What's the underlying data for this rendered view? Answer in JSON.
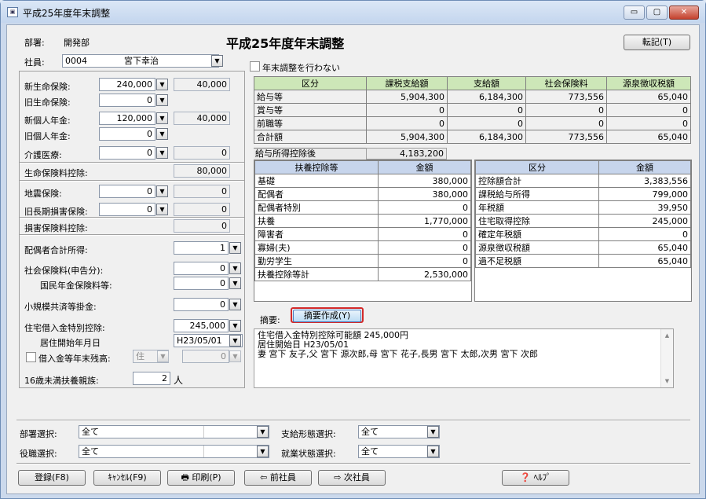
{
  "window": {
    "title": "平成25年度年末調整",
    "icon": "app-icon",
    "minimize": "▭",
    "maximize": "▢",
    "close": "✕"
  },
  "heading": "平成25年度年末調整",
  "transfer_button": "転記(T)",
  "header": {
    "dept_label": "部署:",
    "dept_value": "開発部",
    "employee_label": "社員:",
    "employee_code": "0004",
    "employee_name": "宮下幸治"
  },
  "no_adjust_label": "年末調整を行わない",
  "left": {
    "new_life_label": "新生命保険:",
    "new_life_value": "240,000",
    "new_life_calc": "40,000",
    "old_life_label": "旧生命保険:",
    "old_life_value": "0",
    "new_pension_label": "新個人年金:",
    "new_pension_value": "120,000",
    "new_pension_calc": "40,000",
    "old_pension_label": "旧個人年金:",
    "old_pension_value": "0",
    "care_label": "介護医療:",
    "care_value": "0",
    "care_calc": "0",
    "life_deduction_label": "生命保険料控除:",
    "life_deduction_value": "80,000",
    "earthquake_label": "地震保険:",
    "earthquake_value": "0",
    "earthquake_calc": "0",
    "old_longterm_label": "旧長期損害保険:",
    "old_longterm_value": "0",
    "old_longterm_calc": "0",
    "damage_deduction_label": "損害保険料控除:",
    "damage_deduction_value": "0",
    "spouse_income_label": "配偶者合計所得:",
    "spouse_income_value": "1",
    "social_ins_label": "社会保険料(申告分):",
    "social_ins_value": "0",
    "national_pension_label": "国民年金保険料等:",
    "national_pension_value": "0",
    "small_biz_label": "小規模共済等掛金:",
    "small_biz_value": "0",
    "housing_loan_label": "住宅借入金特別控除:",
    "housing_loan_value": "245,000",
    "residence_start_label": "居住開始年月日",
    "residence_start_value": "H23/05/01",
    "loan_balance_label": "借入金等年末残高:",
    "loan_balance_type": "住",
    "loan_balance_value": "0",
    "under16_label": "16歳未満扶養親族:",
    "under16_value": "2",
    "under16_unit": "人"
  },
  "top_table": {
    "headers": [
      "区分",
      "課税支給額",
      "支給額",
      "社会保険料",
      "源泉徴収税額"
    ],
    "rows": [
      [
        "給与等",
        "5,904,300",
        "6,184,300",
        "773,556",
        "65,040"
      ],
      [
        "賞与等",
        "0",
        "0",
        "0",
        "0"
      ],
      [
        "前職等",
        "0",
        "0",
        "0",
        "0"
      ],
      [
        "合計額",
        "5,904,300",
        "6,184,300",
        "773,556",
        "65,040"
      ]
    ],
    "after_deduction_label": "給与所得控除後",
    "after_deduction_value": "4,183,200"
  },
  "dependents_table": {
    "headers": [
      "扶養控除等",
      "金額"
    ],
    "rows": [
      [
        "基礎",
        "380,000"
      ],
      [
        "配偶者",
        "380,000"
      ],
      [
        "配偶者特別",
        "0"
      ],
      [
        "扶養",
        "1,770,000"
      ],
      [
        "障害者",
        "0"
      ],
      [
        "寡婦(夫)",
        "0"
      ],
      [
        "勤労学生",
        "0"
      ],
      [
        "扶養控除等計",
        "2,530,000"
      ]
    ]
  },
  "tax_table": {
    "headers": [
      "区分",
      "金額"
    ],
    "rows": [
      [
        "控除額合計",
        "3,383,556"
      ],
      [
        "課税給与所得",
        "799,000"
      ],
      [
        "年税額",
        "39,950"
      ],
      [
        "住宅取得控除",
        "245,000"
      ],
      [
        "確定年税額",
        "0"
      ],
      [
        "源泉徴収税額",
        "65,040"
      ],
      [
        "過不足税額",
        "65,040"
      ]
    ]
  },
  "summary": {
    "label": "摘要:",
    "create_button": "摘要作成(Y)",
    "lines": [
      "住宅借入金特別控除可能額 245,000円",
      "居住開始日 H23/05/01",
      "妻 宮下 友子,父 宮下 源次郎,母 宮下 花子,長男 宮下 太郎,次男 宮下 次郎"
    ]
  },
  "filters": {
    "dept_label": "部署選択:",
    "dept_value": "全て",
    "pay_type_label": "支給形態選択:",
    "pay_type_value": "全て",
    "position_label": "役職選択:",
    "position_value": "全て",
    "employment_label": "就業状態選択:",
    "employment_value": "全て"
  },
  "buttons": {
    "register": "登録(F8)",
    "cancel": "ｷｬﾝｾﾙ(F9)",
    "print": "印刷(P)",
    "prev": "前社員",
    "next": "次社員",
    "help": "ﾍﾙﾌﾟ"
  }
}
